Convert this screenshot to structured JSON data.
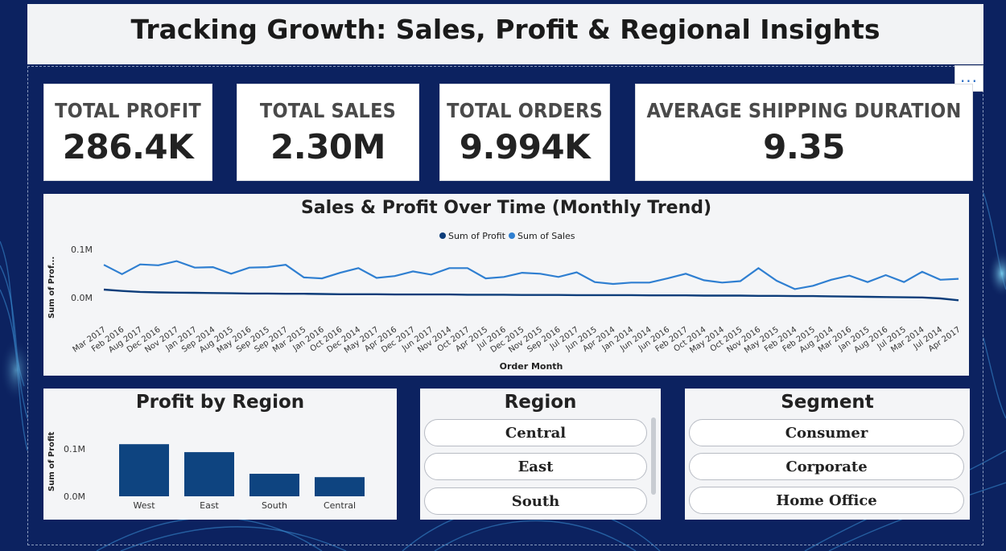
{
  "title": "Tracking Growth: Sales, Profit & Regional Insights",
  "more_options_label": "...",
  "kpis": [
    {
      "label": "TOTAL PROFIT",
      "value": "286.4K"
    },
    {
      "label": "TOTAL SALES",
      "value": "2.30M"
    },
    {
      "label": "TOTAL ORDERS",
      "value": "9.994K"
    },
    {
      "label": "AVERAGE SHIPPING DURATION",
      "value": "9.35"
    }
  ],
  "trend": {
    "title": "Sales & Profit Over Time (Monthly Trend)",
    "legend": [
      "Sum of Profit",
      "Sum of Sales"
    ],
    "ylabel": "Sum of Prof...",
    "xlabel": "Order Month",
    "yticks": [
      "0.1M",
      "0.0M"
    ]
  },
  "region_chart": {
    "title": "Profit by Region",
    "ylabel": "Sum of Profit",
    "yticks": [
      "0.1M",
      "0.0M"
    ]
  },
  "region_slicer": {
    "title": "Region",
    "items": [
      "Central",
      "East",
      "South"
    ]
  },
  "segment_slicer": {
    "title": "Segment",
    "items": [
      "Consumer",
      "Corporate",
      "Home Office"
    ]
  },
  "colors": {
    "profit": "#0d3d7a",
    "sales": "#2f7fd1",
    "bar": "#0e4480",
    "background": "#0c2260"
  },
  "chart_data": [
    {
      "type": "line",
      "title": "Sales & Profit Over Time (Monthly Trend)",
      "xlabel": "Order Month",
      "ylabel": "Sum of Prof...",
      "ylim": [
        0,
        100000
      ],
      "x": [
        "Mar 2017",
        "Feb 2016",
        "Aug 2017",
        "Dec 2016",
        "Nov 2017",
        "Jan 2017",
        "Sep 2014",
        "Aug 2015",
        "May 2016",
        "Sep 2015",
        "Sep 2017",
        "Mar 2015",
        "Jan 2016",
        "Oct 2016",
        "Dec 2014",
        "May 2017",
        "Apr 2016",
        "Dec 2017",
        "Jun 2017",
        "Nov 2014",
        "Oct 2017",
        "Apr 2015",
        "Jul 2016",
        "Dec 2015",
        "Nov 2015",
        "Sep 2016",
        "Jul 2017",
        "Jun 2015",
        "Apr 2014",
        "Jan 2014",
        "Jun 2014",
        "Jun 2016",
        "Feb 2017",
        "Oct 2014",
        "May 2014",
        "Oct 2015",
        "Nov 2016",
        "May 2015",
        "Feb 2014",
        "Feb 2015",
        "Aug 2014",
        "Mar 2016",
        "Jan 2015",
        "Aug 2016",
        "Jul 2015",
        "Mar 2014",
        "Jul 2014",
        "Apr 2017"
      ],
      "series": [
        {
          "name": "Sum of Sales",
          "values": [
            72000,
            52000,
            73000,
            71000,
            80000,
            66000,
            67000,
            53000,
            66000,
            67000,
            72000,
            45000,
            43000,
            55000,
            65000,
            44000,
            48000,
            58000,
            51000,
            65000,
            65000,
            43000,
            46000,
            55000,
            53000,
            46000,
            56000,
            35000,
            31000,
            34000,
            34000,
            43000,
            53000,
            39000,
            34000,
            37000,
            65000,
            38000,
            20000,
            27000,
            40000,
            49000,
            35000,
            50000,
            35000,
            57000,
            40000,
            42000
          ]
        },
        {
          "name": "Sum of Profit",
          "values": [
            19000,
            16000,
            14000,
            13000,
            12500,
            12000,
            11500,
            11000,
            10500,
            10500,
            10000,
            10000,
            9500,
            9000,
            9000,
            9000,
            8500,
            8500,
            8500,
            8500,
            8000,
            8000,
            8000,
            7500,
            7500,
            7500,
            7000,
            7000,
            7000,
            7000,
            6500,
            6500,
            6500,
            6000,
            6000,
            6000,
            5500,
            5500,
            5000,
            5000,
            4500,
            4000,
            3500,
            3000,
            2500,
            2000,
            0,
            -4000
          ]
        }
      ]
    },
    {
      "type": "bar",
      "title": "Profit by Region",
      "ylabel": "Sum of Profit",
      "categories": [
        "West",
        "East",
        "South",
        "Central"
      ],
      "values": [
        108000,
        91500,
        46700,
        39700
      ],
      "ylim": [
        0,
        100000
      ]
    }
  ]
}
